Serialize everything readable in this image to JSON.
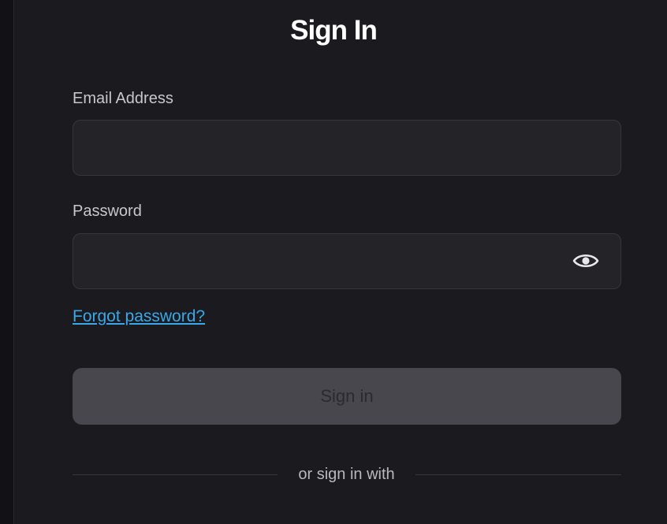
{
  "form": {
    "title": "Sign In",
    "email_label": "Email Address",
    "email_value": "",
    "email_placeholder": "",
    "password_label": "Password",
    "password_value": "",
    "password_placeholder": "",
    "forgot_password_link": "Forgot password?",
    "submit_label": "Sign in",
    "alt_signin_text": "or sign in with"
  },
  "icons": {
    "password_toggle": "eye-icon"
  },
  "colors": {
    "background": "#1b1a1f",
    "input_background": "#242328",
    "link": "#3aa8e8",
    "button_disabled": "#48474d",
    "title": "#ffffff"
  }
}
